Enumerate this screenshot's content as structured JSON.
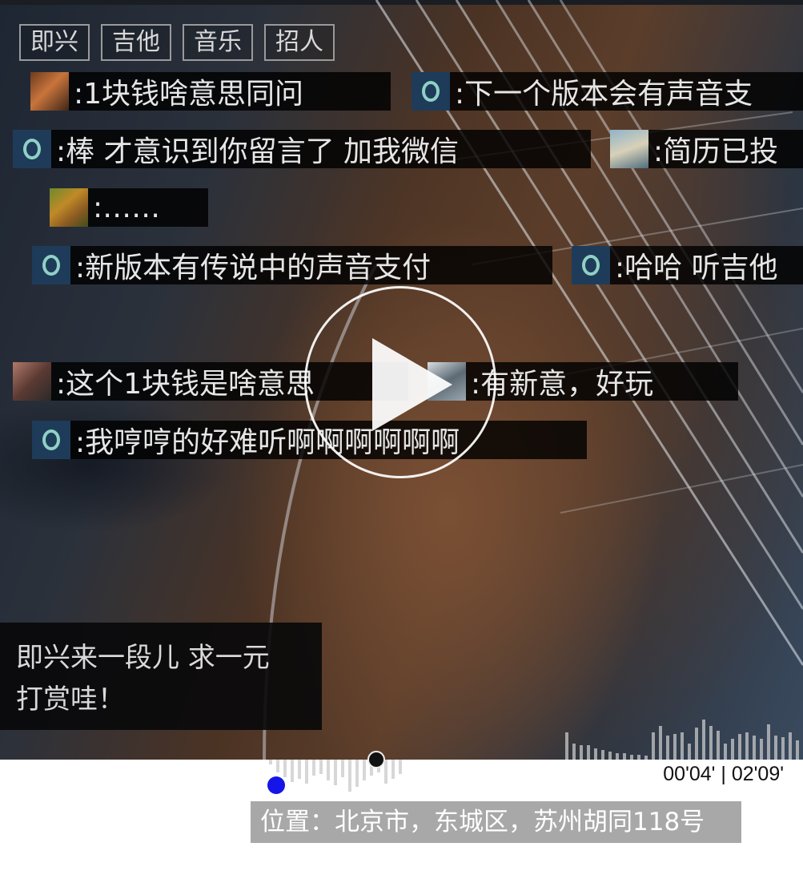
{
  "tags": [
    "即兴",
    "吉他",
    "音乐",
    "招人"
  ],
  "danmaku": [
    {
      "avatar": "photo-a",
      "text": ":1块钱啥意思同问"
    },
    {
      "avatar": "default",
      "text": ":下一个版本会有声音支"
    },
    {
      "avatar": "default",
      "text": ":棒 才意识到你留言了 加我微信"
    },
    {
      "avatar": "photo-b",
      "text": ":简历已投"
    },
    {
      "avatar": "photo-c",
      "text": ":……"
    },
    {
      "avatar": "default",
      "text": ":新版本有传说中的声音支付"
    },
    {
      "avatar": "default",
      "text": ":哈哈 听吉他"
    },
    {
      "avatar": "photo-d",
      "text": ":这个1块钱是啥意思"
    },
    {
      "avatar": "photo-e",
      "text": ":有新意，好玩"
    },
    {
      "avatar": "default",
      "text": ":我哼哼的好难听啊啊啊啊啊啊"
    }
  ],
  "caption": {
    "line1": "即兴来一段儿 求一元",
    "line2": "打赏哇！"
  },
  "player": {
    "time": "00'04' | 02'09'",
    "play_icon": "play-icon",
    "progress_fraction": 0.03
  },
  "location": "位置：北京市，东城区，苏州胡同118号"
}
